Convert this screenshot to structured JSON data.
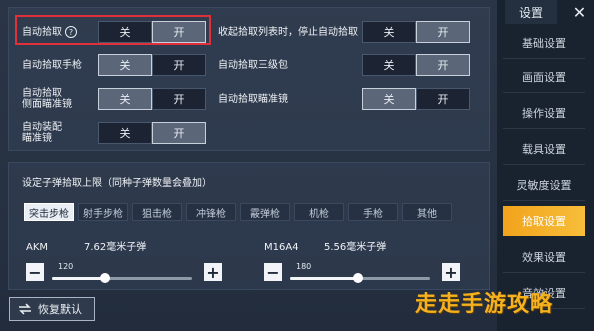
{
  "auto_pickup": {
    "label": "自动拾取",
    "help": "?",
    "off": "关",
    "on": "开"
  },
  "collapse_stop": {
    "label": "收起拾取列表时，停止自动拾取",
    "off": "关",
    "on": "开"
  },
  "pistol": {
    "label": "自动拾取手枪",
    "off": "关",
    "on": "开"
  },
  "level3_bag": {
    "label": "自动拾取三级包",
    "off": "关",
    "on": "开"
  },
  "side_scope": {
    "label_line1": "自动拾取",
    "label_line2": "侧面瞄准镜",
    "off": "关",
    "on": "开"
  },
  "scope": {
    "label": "自动拾取瞄准镜",
    "off": "关",
    "on": "开"
  },
  "attach_scope": {
    "label_line1": "自动装配",
    "label_line2": "瞄准镜",
    "off": "关",
    "on": "开"
  },
  "ammo_limit": {
    "title": "设定子弹拾取上限（同种子弹数量会叠加）",
    "tabs": [
      "突击步枪",
      "射手步枪",
      "狙击枪",
      "冲锋枪",
      "霰弹枪",
      "机枪",
      "手枪",
      "其他"
    ],
    "active_tab": 0,
    "sliders": [
      {
        "gun": "AKM",
        "ammo": "7.62毫米子弹",
        "value": 120,
        "max": 300,
        "fraction": 0.4
      },
      {
        "gun": "M16A4",
        "ammo": "5.56毫米子弹",
        "value": 180,
        "max": 300,
        "fraction": 0.6
      }
    ],
    "minus": "−",
    "plus": "+"
  },
  "reset": {
    "label": "恢复默认",
    "icon": "swap-icon"
  },
  "sidebar": {
    "title": "设置",
    "close": "✕",
    "items": [
      "基础设置",
      "画面设置",
      "操作设置",
      "载具设置",
      "灵敏度设置",
      "拾取设置",
      "效果设置",
      "音效设置"
    ],
    "active": 5
  },
  "watermark": "走走手游攻略",
  "colors": {
    "accent": "#f5a623",
    "highlight_box": "#e0303a"
  }
}
